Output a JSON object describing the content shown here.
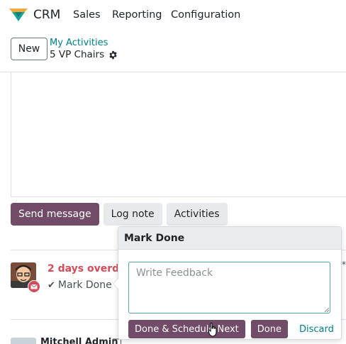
{
  "navbar": {
    "app_name": "CRM",
    "menu": [
      "Sales",
      "Reporting",
      "Configuration"
    ]
  },
  "control_panel": {
    "new_label": "New",
    "breadcrumb": "My Activities",
    "record_title": "5 VP Chairs"
  },
  "chatter": {
    "send_message": "Send message",
    "log_note": "Log note",
    "activities": "Activities"
  },
  "activity": {
    "overdue": "2 days overdue",
    "mark_done": "Mark Done"
  },
  "message": {
    "author": "Mitchell Admin"
  },
  "popover": {
    "title": "Mark Done",
    "feedback_placeholder": "Write Feedback",
    "done_schedule_next": "Done & Schedule Next",
    "done": "Done",
    "discard": "Discard"
  },
  "colors": {
    "primary": "#714b67",
    "link": "#017e84",
    "overdue": "#d44c59"
  }
}
